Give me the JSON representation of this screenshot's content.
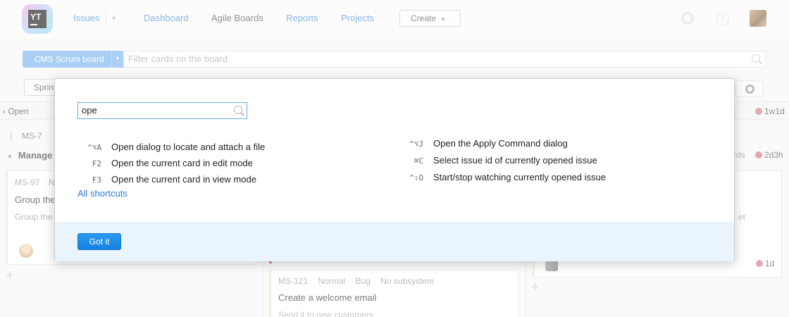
{
  "header": {
    "logo_text": "YT",
    "nav": {
      "issues": "Issues",
      "dashboard": "Dashboard",
      "agile_boards": "Agile Boards",
      "reports": "Reports",
      "projects": "Projects"
    },
    "create_label": "Create"
  },
  "board": {
    "selector_label": "CMS Scrum board",
    "filter_placeholder": "Filter cards on the board",
    "sprint_label": "Sprint"
  },
  "columns": {
    "open_label": "Open",
    "estimate_badge": "1w1d"
  },
  "swimlanes": {
    "ms7_id": "MS-7",
    "manage_label": "Manage",
    "right_partial": "rds",
    "right_estimate": "2d3h"
  },
  "cards": {
    "ms97": {
      "id": "MS-97",
      "priority": "N",
      "title": "Group the",
      "description": "Group the"
    },
    "ms121": {
      "id": "MS-121",
      "priority": "Normal",
      "type": "Bug",
      "subsystem": "No subsystem",
      "title": "Create a welcome email",
      "description": "Send it to new customers"
    },
    "right_card": {
      "text_fragment": "et",
      "estimate": "1d"
    }
  },
  "dialog": {
    "search_value": "ope",
    "left_shortcuts": [
      {
        "key": "^⌥A",
        "description": "Open dialog to locate and attach a file"
      },
      {
        "key": "F2",
        "description": "Open the current card in edit mode"
      },
      {
        "key": "F3",
        "description": "Open the current card in view mode"
      }
    ],
    "right_shortcuts": [
      {
        "key": "^⌥J",
        "description": "Open the Apply Command dialog"
      },
      {
        "key": "⌘C",
        "description": "Select issue id of currently opened issue"
      },
      {
        "key": "^⇧O",
        "description": "Start/stop watching currently opened issue"
      }
    ],
    "all_shortcuts_label": "All shortcuts",
    "got_it_label": "Got it"
  },
  "colors": {
    "accent": "#1681e0",
    "link": "#2f7bcf",
    "footer_bg": "#eaf4fc",
    "estimate_dot": "#d77a85"
  }
}
